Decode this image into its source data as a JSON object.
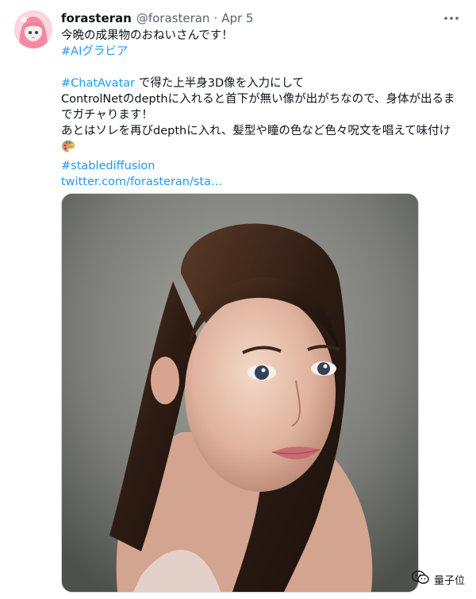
{
  "author": {
    "display_name": "forasteran",
    "handle": "@forasteran",
    "separator": "·",
    "date": "Apr 5",
    "avatar_icon": "anime-avatar-icon"
  },
  "tweet": {
    "line1": "今晩の成果物のおねいさんです！",
    "hashtag1": "#AIグラビア",
    "hashtag2": "#ChatAvatar",
    "line3_rest": " で得た上半身3D像を入力にして",
    "line4": "ControlNetのdepthに入れると首下が無い像が出がちなので、身体が出るまでガチャります！",
    "line5": "あとはソレを再びdepthに入れ、髪型や瞳の色など色々呪文を唱えて味付け",
    "emoji": "artist-palette-icon",
    "hashtag3": "#stablediffusion",
    "link": "twitter.com/forasteran/sta..."
  },
  "media": {
    "alt_icon": "portrait-photo"
  },
  "watermark": {
    "label": "量子位",
    "icon": "wechat-icon"
  },
  "colors": {
    "link": "#1d9bf0",
    "text": "#0f1419",
    "muted": "#536471"
  }
}
